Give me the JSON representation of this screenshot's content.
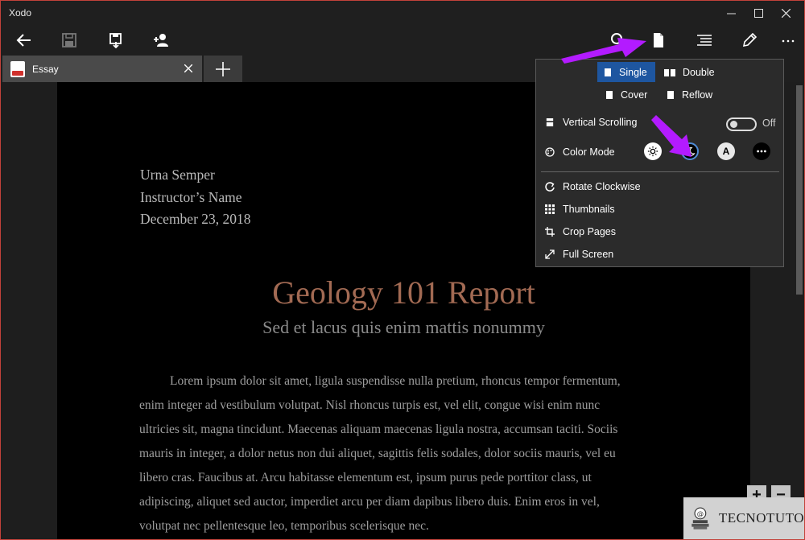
{
  "window": {
    "title": "Xodo"
  },
  "tabs": [
    {
      "label": "Essay"
    }
  ],
  "document": {
    "author_lines": [
      "Urna Semper",
      "Instructor’s Name",
      "December 23, 2018"
    ],
    "title": "Geology 101 Report",
    "subtitle": "Sed et lacus quis enim mattis nonummy",
    "body_lines": [
      "Lorem ipsum dolor sit amet, ligula suspendisse nulla pretium, rhoncus tempor fermentum,",
      "enim integer ad vestibulum volutpat. Nisl rhoncus turpis est, vel elit, congue wisi enim nunc",
      "ultricies sit, magna tincidunt. Maecenas aliquam maecenas ligula nostra, accumsan taciti. Sociis",
      "mauris in integer, a dolor netus non dui aliquet, sagittis felis sodales, dolor sociis mauris, vel eu",
      "libero cras. Faucibus at. Arcu habitasse elementum est, ipsum purus pede porttitor class, ut",
      "adipiscing, aliquet sed auctor, imperdiet arcu per diam dapibus libero duis. Enim eros in vel,",
      "volutpat nec pellentesque leo, temporibus scelerisque nec."
    ]
  },
  "view_menu": {
    "page_modes": [
      {
        "label": "Single",
        "active": true
      },
      {
        "label": "Double",
        "active": false
      },
      {
        "label": "Cover",
        "active": false
      },
      {
        "label": "Reflow",
        "active": false
      }
    ],
    "vertical_scrolling": {
      "label": "Vertical Scrolling",
      "state": "Off"
    },
    "color_mode": {
      "label": "Color Mode",
      "options": [
        "day",
        "night",
        "A",
        "more"
      ],
      "selected": "night"
    },
    "actions": [
      "Rotate Clockwise",
      "Thumbnails",
      "Crop Pages",
      "Full Screen"
    ]
  },
  "zoom": {
    "in": "+",
    "out": "−"
  },
  "watermark": {
    "text": "TECNOTUTO"
  },
  "colors": {
    "accent": "#1e56a0",
    "annotation_arrow": "#b31bff",
    "title_text": "#a26a53",
    "window_border": "#c2423a"
  },
  "icons": [
    "back-arrow-icon",
    "save-icon",
    "save-as-icon",
    "add-user-icon",
    "search-icon",
    "page-view-icon",
    "outline-icon",
    "pen-icon",
    "more-icon"
  ]
}
